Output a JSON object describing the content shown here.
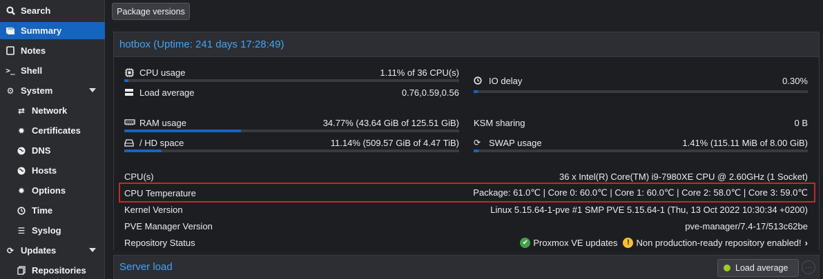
{
  "sidebar": {
    "items": [
      {
        "label": "Search",
        "icon": "search-icon"
      },
      {
        "label": "Summary",
        "icon": "book-icon"
      },
      {
        "label": "Notes",
        "icon": "notes-icon"
      },
      {
        "label": "Shell",
        "icon": "terminal-icon"
      },
      {
        "label": "System",
        "icon": "gears-icon"
      },
      {
        "label": "Network",
        "icon": "exchange-icon"
      },
      {
        "label": "Certificates",
        "icon": "certificate-icon"
      },
      {
        "label": "DNS",
        "icon": "globe-icon"
      },
      {
        "label": "Hosts",
        "icon": "globe-icon"
      },
      {
        "label": "Options",
        "icon": "gear-icon"
      },
      {
        "label": "Time",
        "icon": "clock-icon"
      },
      {
        "label": "Syslog",
        "icon": "list-icon"
      },
      {
        "label": "Updates",
        "icon": "refresh-icon"
      },
      {
        "label": "Repositories",
        "icon": "files-icon"
      }
    ],
    "active": "Summary"
  },
  "toolbar": {
    "package_versions_label": "Package versions"
  },
  "status": {
    "title": "hotbox (Uptime: 241 days 17:28:49)",
    "cpu_usage": {
      "label": "CPU usage",
      "value": "1.11% of 36 CPU(s)",
      "fraction": 0.0111
    },
    "io_delay": {
      "label": "IO delay",
      "value": "0.30%",
      "fraction": 0.003
    },
    "load_average": {
      "label": "Load average",
      "value": "0.76,0.59,0.56"
    },
    "ram_usage": {
      "label": "RAM usage",
      "value": "34.77% (43.64 GiB of 125.51 GiB)",
      "fraction": 0.3477
    },
    "ksm_sharing": {
      "label": "KSM sharing",
      "value": "0 B"
    },
    "hd_space": {
      "label": "/ HD space",
      "value": "11.14% (509.57 GiB of 4.47 TiB)",
      "fraction": 0.1114
    },
    "swap_usage": {
      "label": "SWAP usage",
      "value": "1.41% (115.11 MiB of 8.00 GiB)",
      "fraction": 0.0141
    },
    "cpus": {
      "label": "CPU(s)",
      "value": "36 x Intel(R) Core(TM) i9-7980XE CPU @ 2.60GHz (1 Socket)"
    },
    "cpu_temperature": {
      "label": "CPU Temperature",
      "value": "Package: 61.0℃ | Core 0: 60.0℃ | Core 1: 60.0℃ | Core 2: 58.0℃ | Core 3: 59.0℃"
    },
    "kernel_version": {
      "label": "Kernel Version",
      "value": "Linux 5.15.64-1-pve #1 SMP PVE 5.15.64-1 (Thu, 13 Oct 2022 10:30:34 +0200)"
    },
    "pve_manager_version": {
      "label": "PVE Manager Version",
      "value": "pve-manager/7.4-17/513c62be"
    },
    "repository_status": {
      "label": "Repository Status",
      "ok_text": "Proxmox VE updates",
      "warn_text": "Non production-ready repository enabled!"
    }
  },
  "server_load": {
    "title": "Server load",
    "button_label": "Load average"
  },
  "colors": {
    "accent": "#1565c0",
    "link": "#42a5f5",
    "highlight_border": "#c62828",
    "ok": "#43a047",
    "warning": "#fbc02d"
  }
}
